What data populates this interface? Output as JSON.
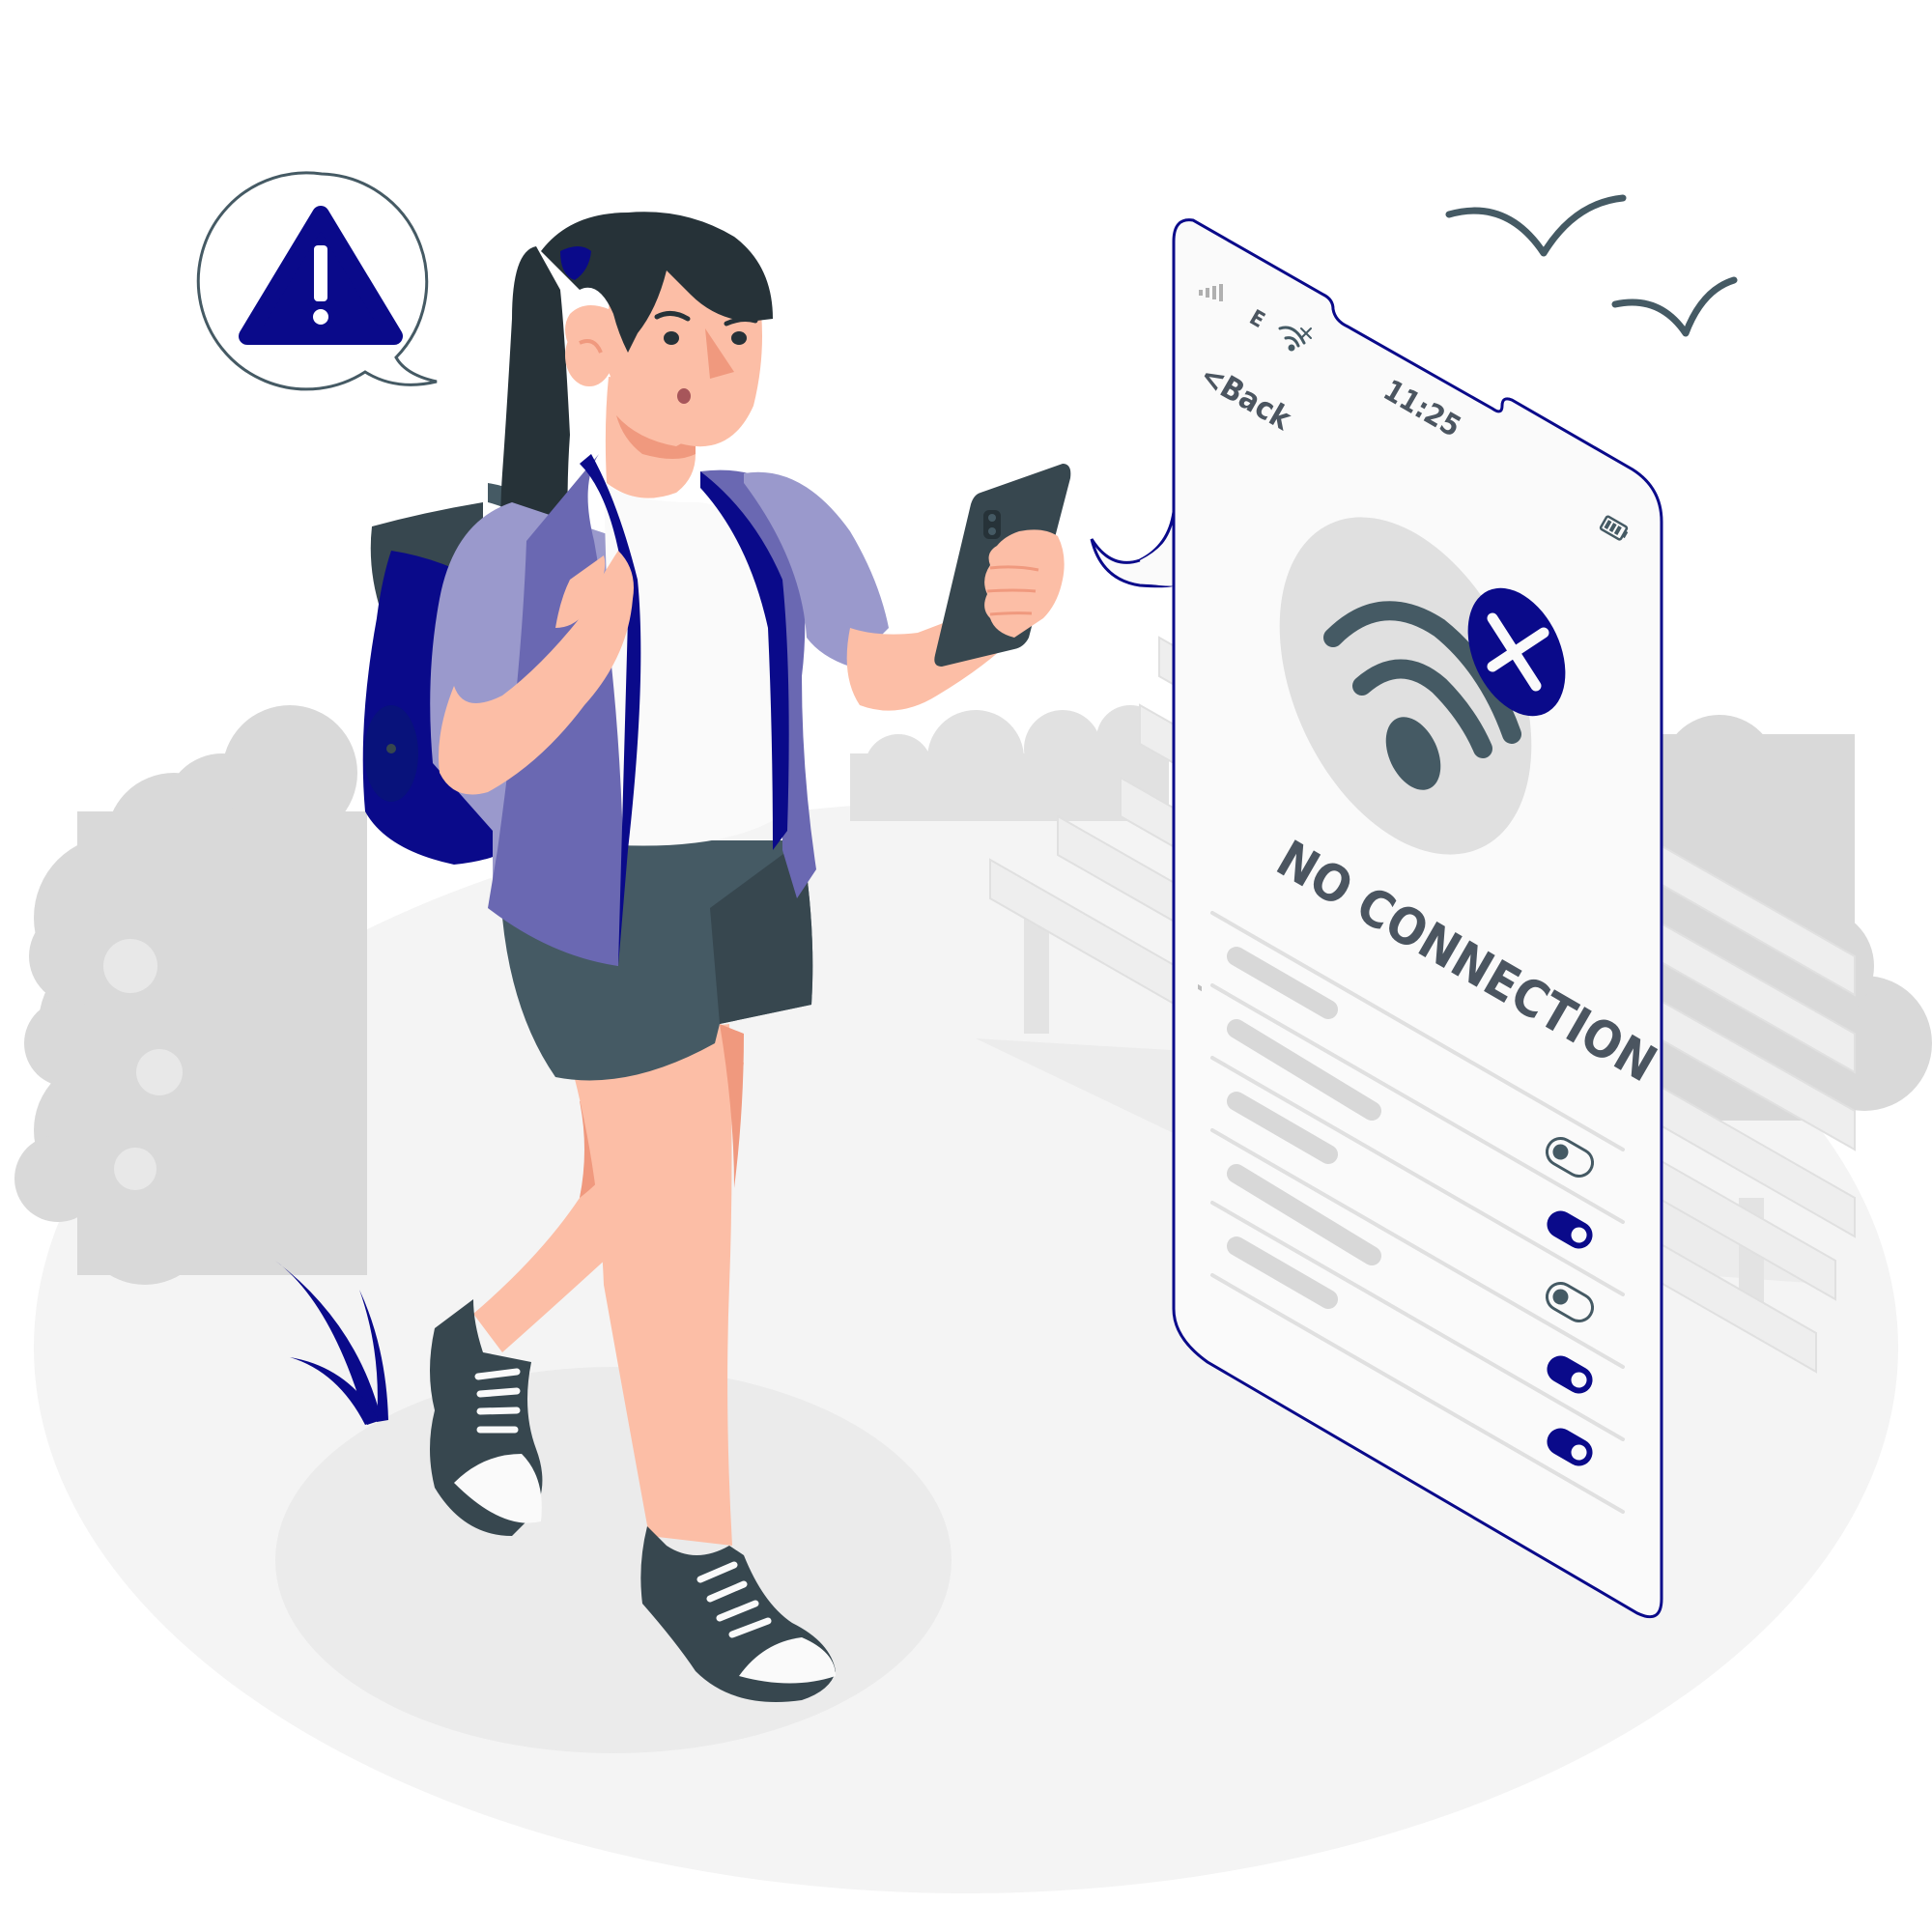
{
  "phone": {
    "network_type": "E",
    "back_label": "<Back",
    "time": "11:25",
    "message": "NO CONNECTION",
    "toggles": [
      {
        "state": "off"
      },
      {
        "state": "on"
      },
      {
        "state": "off"
      },
      {
        "state": "on"
      },
      {
        "state": "on"
      }
    ]
  },
  "colors": {
    "accent": "#0a0a8a",
    "dark": "#263238",
    "slate": "#455a64",
    "skin": "#fcbea6",
    "jacket": "#6a68b2",
    "jacket_light": "#9a99cc",
    "ground": "#f4f4f4",
    "bush": "#d9d9d9"
  },
  "icons": {
    "alert_bubble": "warning-icon",
    "wifi_status": "wifi-off-icon"
  }
}
